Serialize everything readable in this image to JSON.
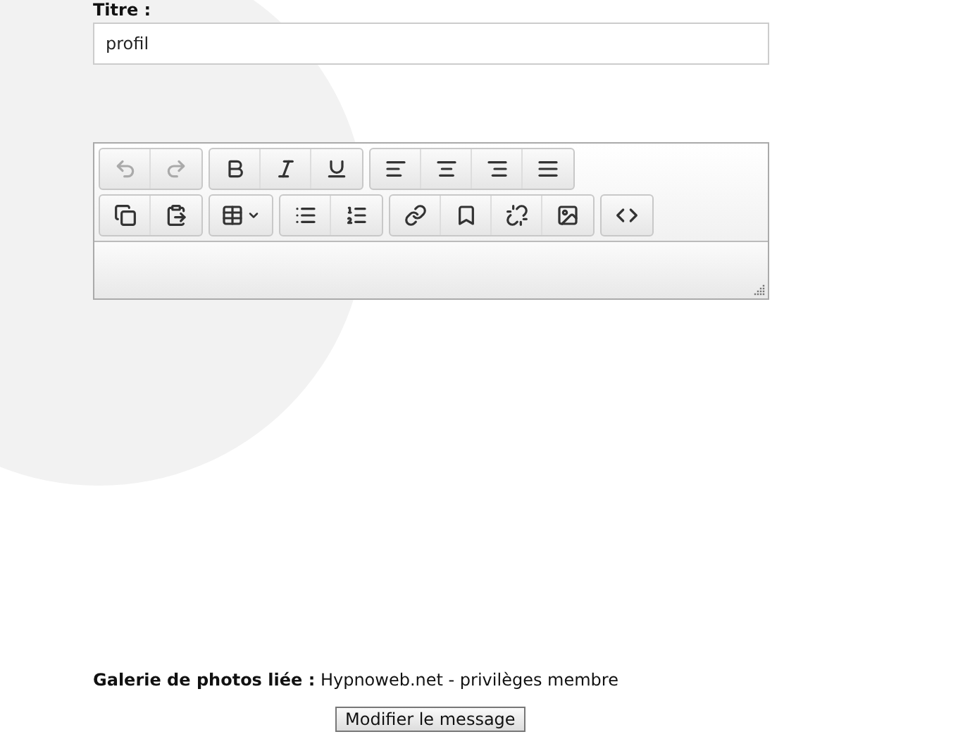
{
  "title_field": {
    "label": "Titre :",
    "value": "profil"
  },
  "editor": {
    "toolbar_rows": [
      [
        [
          {
            "kind": "undo",
            "disabled": true
          },
          {
            "kind": "redo",
            "disabled": true
          }
        ],
        [
          {
            "kind": "bold",
            "disabled": false
          },
          {
            "kind": "italic",
            "disabled": false
          },
          {
            "kind": "underline",
            "disabled": false
          }
        ],
        [
          {
            "kind": "align-left",
            "disabled": false
          },
          {
            "kind": "align-center",
            "disabled": false
          },
          {
            "kind": "align-right",
            "disabled": false
          },
          {
            "kind": "justify",
            "disabled": false
          }
        ]
      ],
      [
        [
          {
            "kind": "copy",
            "disabled": false
          },
          {
            "kind": "paste",
            "disabled": false
          }
        ],
        [
          {
            "kind": "table",
            "disabled": false
          }
        ],
        [
          {
            "kind": "bullet-list",
            "disabled": false
          },
          {
            "kind": "numbered-list",
            "disabled": false
          }
        ],
        [
          {
            "kind": "link",
            "disabled": false
          },
          {
            "kind": "bookmark",
            "disabled": false
          },
          {
            "kind": "unlink",
            "disabled": false
          },
          {
            "kind": "image",
            "disabled": false
          }
        ],
        [
          {
            "kind": "code",
            "disabled": false
          }
        ]
      ]
    ]
  },
  "gallery": {
    "label": "Galerie de photos liée :",
    "value": "Hypnoweb.net - privilèges membre"
  },
  "submit_button": "Modifier le message"
}
